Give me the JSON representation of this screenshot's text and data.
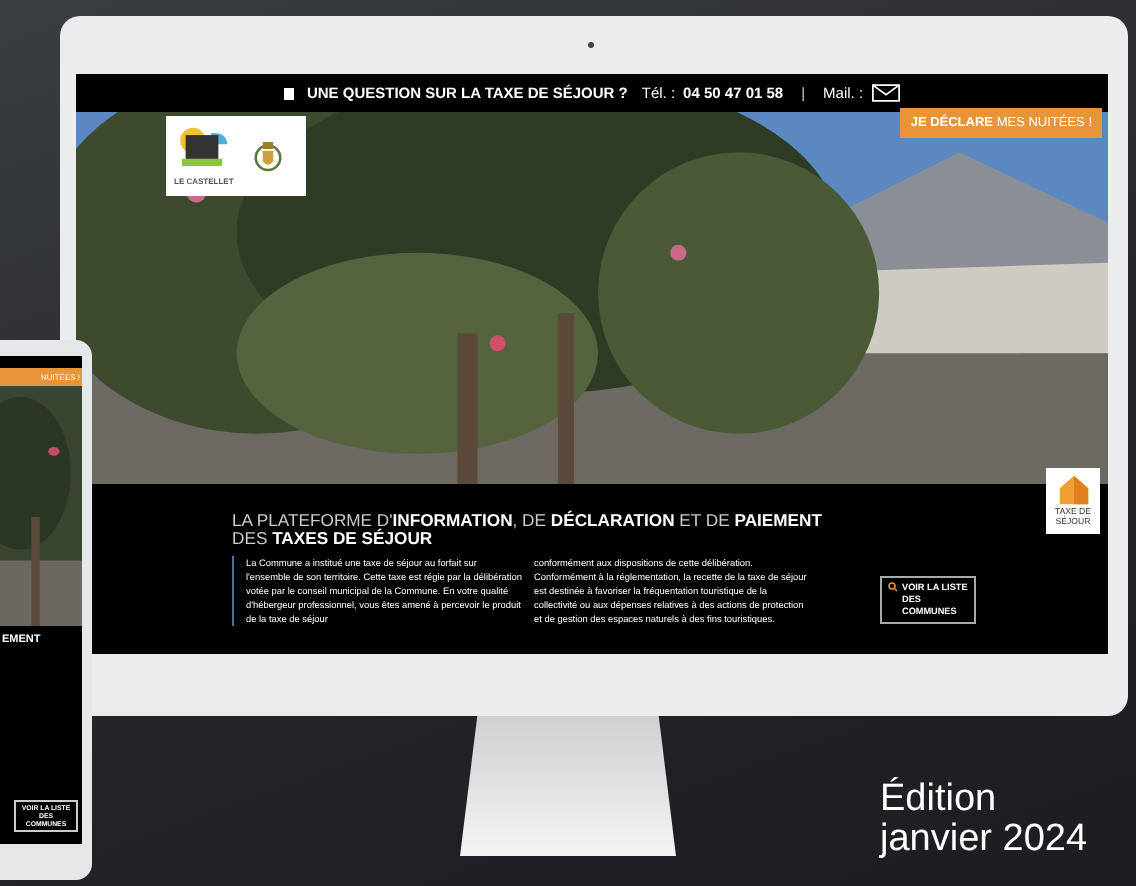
{
  "top_bar": {
    "question": "UNE QUESTION SUR LA TAXE DE SÉJOUR ?",
    "phone_label": "Tél. :",
    "phone": "04 50 47 01 58",
    "separator": "|",
    "mail_label": "Mail. :"
  },
  "hero": {
    "logo_text": "LE CASTELLET",
    "declare_button": "**JE DÉCLARE** MES NUITÉES !",
    "tax_badge": "TAXE DE SÉJOUR"
  },
  "intro": {
    "heading": "LA PLATEFORME D'**INFORMATION**, DE **DÉCLARATION** ET DE **PAIEMENT** DES **TAXES DE SÉJOUR**",
    "paragraphs": [
      "La Commune  a institué une taxe de séjour au forfait sur l'ensemble de son territoire. Cette taxe est régie par la délibération votée par le conseil municipal de la Commune. En votre qualité d'hébergeur professionnel, vous êtes amené à percevoir le produit de la taxe de séjour",
      "conformément aux dispositions de cette délibération. Conformément à la réglementation, la recette de la taxe de séjour est destinée à favoriser la fréquentation touristique de la collectivité ou aux dépenses relatives à des actions de protection et de gestion des espaces naturels à des fins touristiques."
    ],
    "button": "VOIR LA LISTE DES COMMUNES"
  },
  "phone_preview": {
    "declare_button": "NUITÉES !",
    "heading": "EMENT",
    "button": "VOIR LA LISTE DES COMMUNES"
  },
  "edition": [
    "Édition",
    "janvier 2024"
  ]
}
